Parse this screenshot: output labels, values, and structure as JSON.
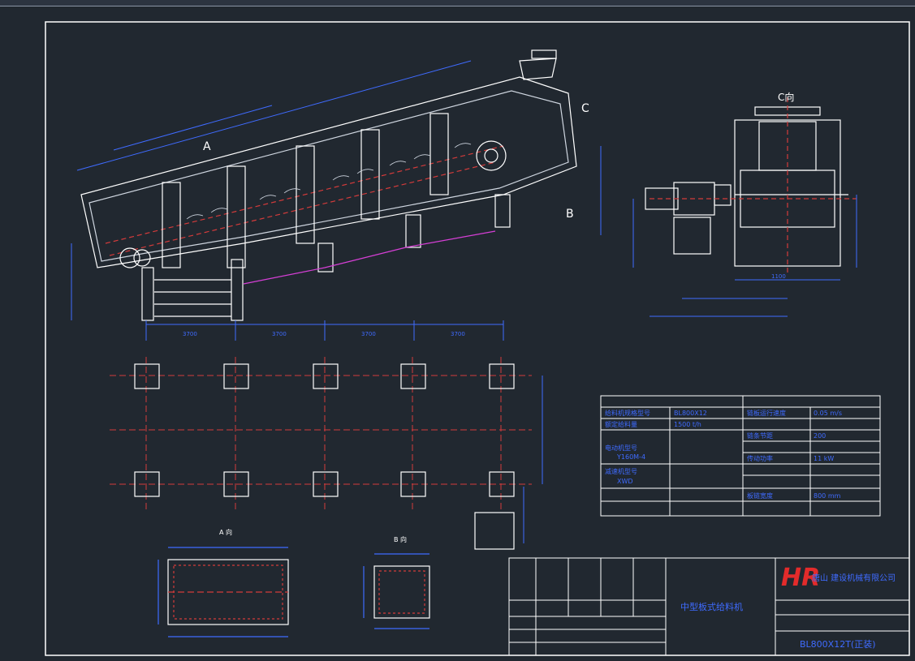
{
  "drawing": {
    "title_block": {
      "logo": "HR",
      "company": "唐山 建设机械有限公司",
      "drawing_name": "中型板式给料机",
      "drawing_number": "BL800X12T(正装)"
    },
    "view_labels": {
      "view_c": "C向",
      "arrow_c": "C",
      "arrow_b": "B",
      "arrow_a": "A",
      "section_a": "A 向",
      "section_b": "B 向"
    },
    "dimensions": {
      "bay_widths": [
        "3700",
        "3700",
        "3700",
        "3700"
      ],
      "side_width": "1100"
    },
    "specs": {
      "rows": [
        [
          "给料机规格型号",
          "BL800X12"
        ],
        [
          "额定给料量",
          "1500 t/h"
        ],
        [
          "链板运行速度",
          "0.05 m/s"
        ],
        [
          "电动机型号",
          "Y160M-4"
        ],
        [
          "减速机型号",
          "XWD"
        ],
        [
          "链条节距",
          "200"
        ],
        [
          "传动功率",
          "11 kW"
        ],
        [
          "板链宽度",
          "800 mm"
        ]
      ]
    }
  }
}
